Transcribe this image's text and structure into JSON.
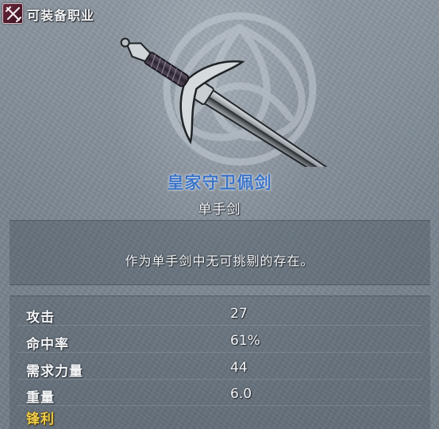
{
  "header": {
    "class_icon": "crossed-weapons-icon",
    "class_label": "可装备职业"
  },
  "item": {
    "icon": "sword-icon",
    "name": "皇家守卫佩剑",
    "type": "单手剑",
    "description": "作为单手剑中无可挑剔的存在。"
  },
  "stats": [
    {
      "label": "攻击",
      "value": "27"
    },
    {
      "label": "命中率",
      "value": "61%"
    },
    {
      "label": "需求力量",
      "value": "44"
    },
    {
      "label": "重量",
      "value": "6.0"
    }
  ],
  "traits": [
    "锋利"
  ],
  "colors": {
    "item_name": "#3b73c6",
    "trait": "#f0cc4a",
    "text": "#f4f5f7"
  }
}
